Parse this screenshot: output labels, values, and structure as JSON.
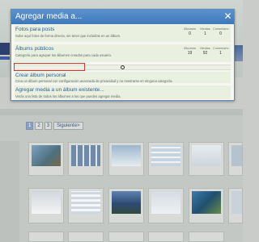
{
  "dialog": {
    "title": "Agregar media a...",
    "close_label": "✕",
    "sections": [
      {
        "title": "Fotos para posts",
        "description": "Sube aquí fotos de forma directa, sin tener que incluirlas en un álbum.",
        "stats": [
          {
            "label": "Álbumes",
            "value": "0"
          },
          {
            "label": "Medias",
            "value": "1"
          },
          {
            "label": "Comentario",
            "value": "0"
          }
        ]
      },
      {
        "title": "Álbums públicos",
        "description": "Categoría para agrupar los álbumes creados para cada usuario.",
        "stats": [
          {
            "label": "Álbumes",
            "value": "19"
          },
          {
            "label": "Medias",
            "value": "92"
          },
          {
            "label": "Comentario",
            "value": "1"
          }
        ]
      },
      {
        "title": "Crear álbum personal",
        "description": "Crea un álbum personal con configuración avanzada de privacidad y no mostrarse en ninguna categoría."
      },
      {
        "title": "Agregar media a un álbum existente...",
        "description": "Verás una lista de todos los álbumes a los que puedes agregar media."
      }
    ],
    "collapse_icon": "circle-toggle-icon"
  },
  "pager": {
    "pages": [
      "1",
      "2",
      "3"
    ],
    "current": "1",
    "next_label": "Siguiente>"
  },
  "colors": {
    "header": "#4a85c6",
    "section_bg": "#e9f0df",
    "link": "#2f5f97",
    "highlight": "#d23a2e"
  }
}
